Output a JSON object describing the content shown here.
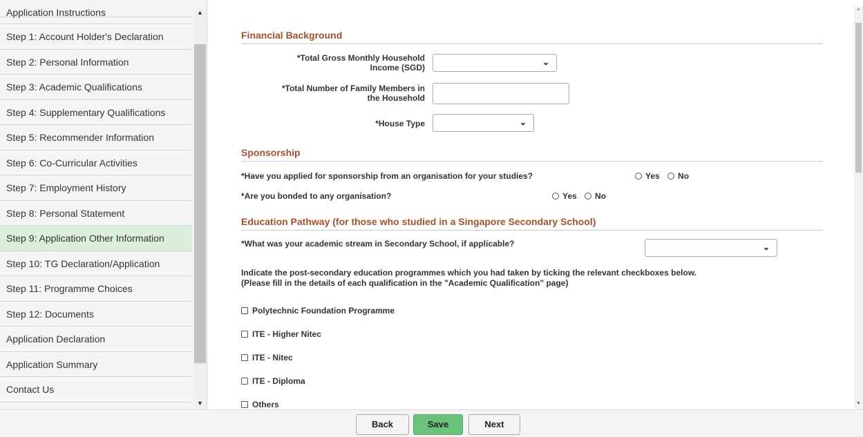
{
  "sidebar": {
    "items": [
      {
        "label": "Application Instructions"
      },
      {
        "label": "Step 1: Account Holder's Declaration"
      },
      {
        "label": "Step 2: Personal Information"
      },
      {
        "label": "Step 3: Academic Qualifications"
      },
      {
        "label": "Step 4: Supplementary Qualifications"
      },
      {
        "label": "Step 5: Recommender Information"
      },
      {
        "label": "Step 6: Co-Curricular Activities"
      },
      {
        "label": "Step 7: Employment History"
      },
      {
        "label": "Step 8: Personal Statement"
      },
      {
        "label": "Step 9: Application Other Information"
      },
      {
        "label": "Step 10: TG Declaration/Application"
      },
      {
        "label": "Step 11: Programme Choices"
      },
      {
        "label": "Step 12: Documents"
      },
      {
        "label": "Application Declaration"
      },
      {
        "label": "Application Summary"
      },
      {
        "label": "Contact Us"
      }
    ],
    "active_label": "Step 9: Application Other Information",
    "scroll_up_icon": "▲",
    "scroll_down_icon": "▼"
  },
  "financial": {
    "title": "Financial Background",
    "income_label_line1": "*Total Gross Monthly Household",
    "income_label_line2": "Income (SGD)",
    "family_label_line1": "*Total Number of Family Members in",
    "family_label_line2": "the Household",
    "house_label": "*House Type",
    "income_value": "",
    "family_value": "",
    "house_value": ""
  },
  "sponsorship": {
    "title": "Sponsorship",
    "q1": "*Have you applied for sponsorship from an organisation for your studies?",
    "q2": "*Are you bonded to any organisation?",
    "yes": "Yes",
    "no": "No"
  },
  "education": {
    "title": "Education Pathway (for those who studied in a Singapore Secondary School)",
    "stream_label": "*What was your academic stream in Secondary School, if applicable?",
    "stream_value": "",
    "instructions_line1": "Indicate the post-secondary education programmes which you had taken by ticking the relevant checkboxes below.",
    "instructions_line2": "(Please fill in the details of each qualification in the \"Academic Qualification\" page)",
    "options": [
      {
        "label": "Polytechnic Foundation Programme"
      },
      {
        "label": "ITE - Higher Nitec"
      },
      {
        "label": "ITE - Nitec"
      },
      {
        "label": "ITE - Diploma"
      },
      {
        "label": "Others"
      }
    ]
  },
  "footer": {
    "back": "Back",
    "save": "Save",
    "next": "Next"
  },
  "colors": {
    "accent_title": "#a0522d",
    "active_nav": "#dcefdc",
    "save_button": "#6bc27c"
  }
}
